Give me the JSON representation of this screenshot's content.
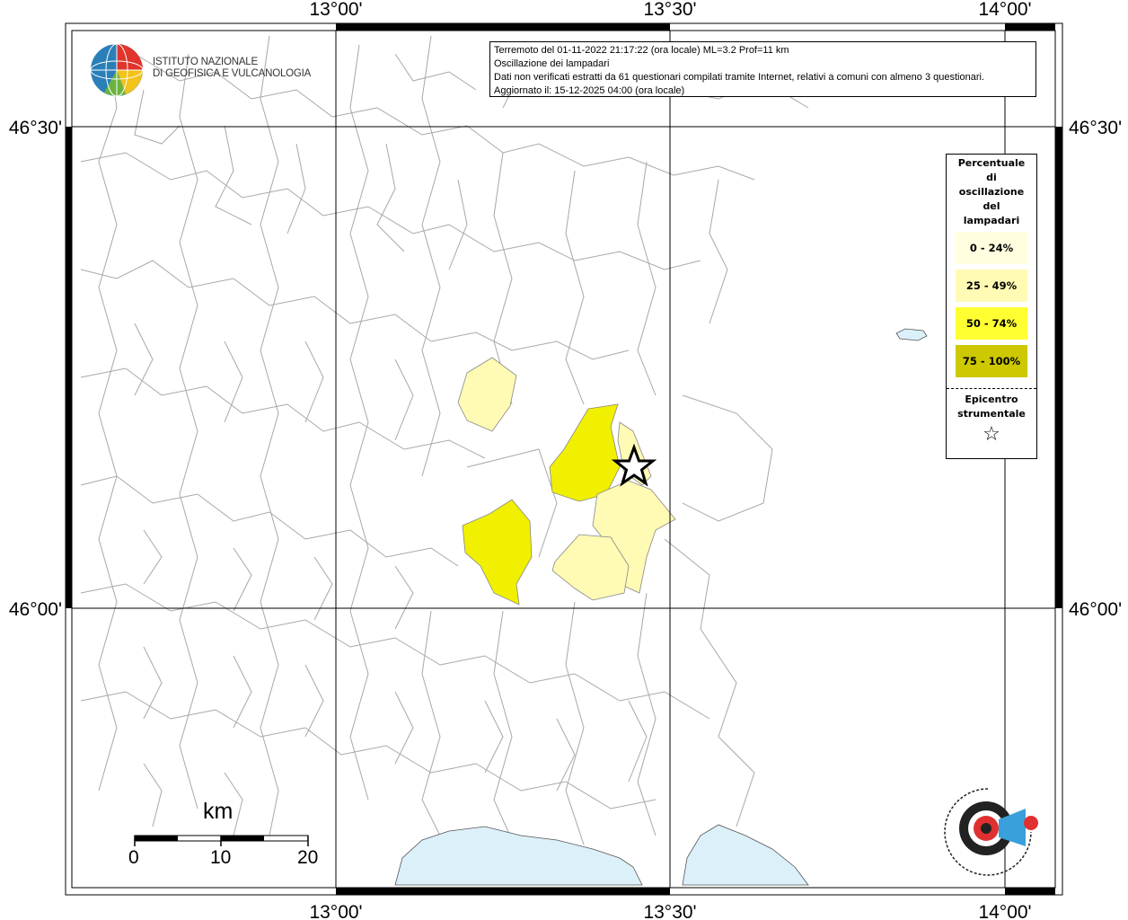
{
  "map": {
    "lon_labels_top": [
      "13°00'",
      "13°30'",
      "14°00'"
    ],
    "lon_labels_bottom": [
      "13°00'",
      "13°30'",
      "14°00'"
    ],
    "lat_labels_left": [
      "46°30'",
      "46°00'"
    ],
    "lat_labels_right": [
      "46°30'",
      "46°00'"
    ]
  },
  "info": {
    "line1": "Terremoto del 01-11-2022 21:17:22 (ora locale) ML=3.2 Prof=11 km",
    "line2": "Oscillazione dei lampadari",
    "line3": "Dati non verificati estratti da 61 questionari compilati tramite Internet, relativi a comuni con almeno 3 questionari.",
    "line4": "Aggiornato il: 15-12-2025 04:00 (ora locale)"
  },
  "institute": {
    "line1": "ISTITUTO NAZIONALE",
    "line2": "DI GEOFISICA E VULCANOLOGIA"
  },
  "legend": {
    "title_lines": [
      "Percentuale",
      "di",
      "oscillazione",
      "del",
      "lampadari"
    ],
    "classes": [
      {
        "label": "0 - 24%",
        "color": "#ffffe0"
      },
      {
        "label": "25 - 49%",
        "color": "#fffab4"
      },
      {
        "label": "50 - 74%",
        "color": "#ffff32"
      },
      {
        "label": "75 - 100%",
        "color": "#cdc800"
      }
    ],
    "epicenter_lines": [
      "Epicentro",
      "strumentale"
    ],
    "epicenter_symbol": "☆"
  },
  "scale_bar": {
    "unit": "km",
    "ticks": [
      "0",
      "10",
      "20"
    ]
  },
  "colors": {
    "water": "#dcf0fa",
    "border": "#9a9a9a",
    "class_25_49": "#fffab4",
    "class_50_74": "#f0f000"
  }
}
